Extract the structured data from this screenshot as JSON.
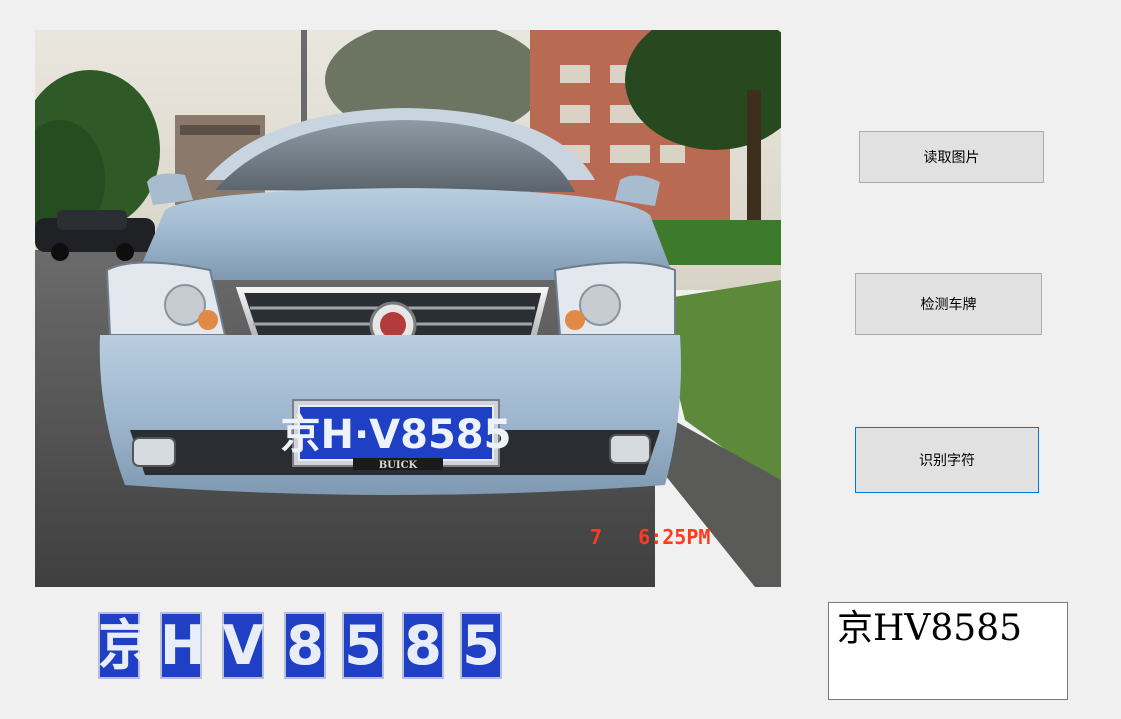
{
  "photo": {
    "plate_text": "京H·V8585",
    "plate_brand": "BUICK",
    "timestamp": "7   6:25PM"
  },
  "buttons": {
    "read_image": "读取图片",
    "detect_plate": "检测车牌",
    "recognize_chars": "识别字符"
  },
  "segmented_chars": [
    "京",
    "H",
    "V",
    "8",
    "5",
    "8",
    "5"
  ],
  "result": {
    "text": "京HV8585"
  },
  "colors": {
    "plate_blue": "#1f3fc4",
    "button_bg": "#e1e1e1",
    "focus_border": "#0078d7",
    "timestamp_red": "#ff3b1f"
  }
}
